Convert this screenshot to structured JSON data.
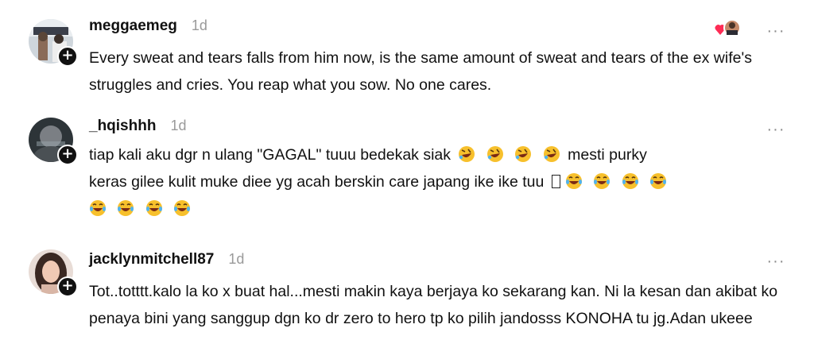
{
  "comments": [
    {
      "username": "meggaemeg",
      "time": "1d",
      "text": "Every sweat and tears falls from him now, is the same amount of sweat and tears of the ex wife's struggles and cries. You reap what you sow. No one cares.",
      "avatar_icon": "profile-photo",
      "follow_icon": "plus-icon"
    },
    {
      "username": "_hqishhh",
      "time": "1d",
      "text_line1": "tiap kali aku dgr n ulang \"GAGAL\" tuuu bedekak siak",
      "text_line1b": "mesti purky",
      "text_line2": "keras gilee kulit muke diee yg acah berskin care japang ike ike tuu",
      "avatar_icon": "profile-photo",
      "follow_icon": "plus-icon"
    },
    {
      "username": "jacklynmitchell87",
      "time": "1d",
      "text": "Tot..totttt.kalo la ko x buat hal...mesti makin kaya berjaya ko sekarang kan. Ni la kesan dan akibat ko penaya bini yang sanggup dgn ko dr zero to hero tp ko pilih jandosss KONOHA tu jg.Adan ukeee",
      "avatar_icon": "profile-photo",
      "follow_icon": "plus-icon"
    }
  ],
  "more_label": "···",
  "colors": {
    "text": "#111111",
    "muted": "#9a9a9a",
    "badge": "#111111",
    "heart": "#fe2c55"
  }
}
